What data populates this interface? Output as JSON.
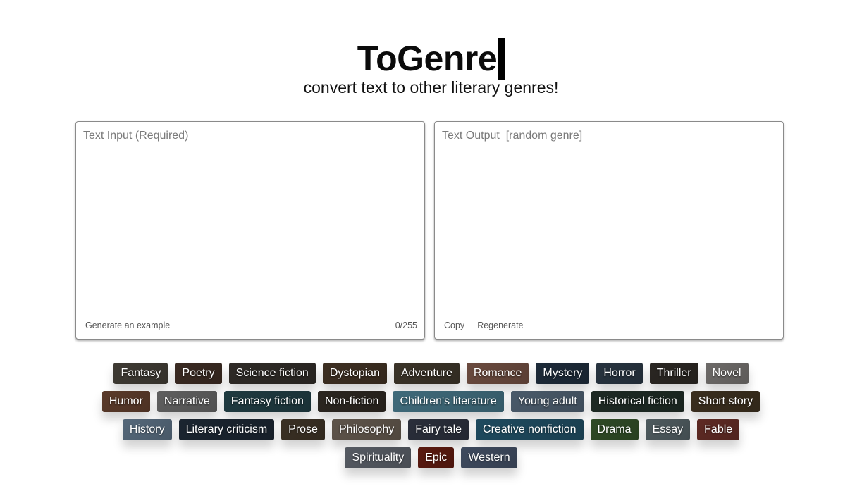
{
  "header": {
    "title": "ToGenre",
    "subtitle": "convert text to other literary genres!"
  },
  "input_panel": {
    "placeholder": "Text Input (Required)",
    "generate_label": "Generate an example",
    "counter": "0/255"
  },
  "output_panel": {
    "placeholder": "Text Output  [random genre]",
    "copy_label": "Copy",
    "regenerate_label": "Regenerate"
  },
  "genres": [
    {
      "label": "Fantasy",
      "color": "#3e3a33"
    },
    {
      "label": "Poetry",
      "color": "#3a2a22"
    },
    {
      "label": "Science fiction",
      "color": "#2e2a26"
    },
    {
      "label": "Dystopian",
      "color": "#3d2f22"
    },
    {
      "label": "Adventure",
      "color": "#3a3328"
    },
    {
      "label": "Romance",
      "color": "#6a4a3e"
    },
    {
      "label": "Mystery",
      "color": "#1d2a38"
    },
    {
      "label": "Horror",
      "color": "#27333f"
    },
    {
      "label": "Thriller",
      "color": "#2a2622"
    },
    {
      "label": "Novel",
      "color": "#6d6a68"
    },
    {
      "label": "Humor",
      "color": "#5a3a2a"
    },
    {
      "label": "Narrative",
      "color": "#5f5f5f"
    },
    {
      "label": "Fantasy fiction",
      "color": "#1f3a40"
    },
    {
      "label": "Non-fiction",
      "color": "#2b2620"
    },
    {
      "label": "Children's literature",
      "color": "#3f6a7a"
    },
    {
      "label": "Young adult",
      "color": "#4a5a6a"
    },
    {
      "label": "Historical fiction",
      "color": "#1e2a24"
    },
    {
      "label": "Short story",
      "color": "#3a2e1e"
    },
    {
      "label": "History",
      "color": "#55687a"
    },
    {
      "label": "Literary criticism",
      "color": "#1b2530"
    },
    {
      "label": "Prose",
      "color": "#3a3024"
    },
    {
      "label": "Philosophy",
      "color": "#5e544a"
    },
    {
      "label": "Fairy tale",
      "color": "#2a2e3a"
    },
    {
      "label": "Creative nonfiction",
      "color": "#1f4a5e"
    },
    {
      "label": "Drama",
      "color": "#2f4a26"
    },
    {
      "label": "Essay",
      "color": "#4e5a5e"
    },
    {
      "label": "Fable",
      "color": "#5e2a24"
    },
    {
      "label": "Spirituality",
      "color": "#555a62"
    },
    {
      "label": "Epic",
      "color": "#5a1a10"
    },
    {
      "label": "Western",
      "color": "#3e4a5e"
    }
  ]
}
